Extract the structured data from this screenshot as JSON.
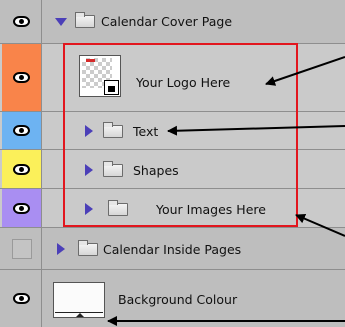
{
  "layers_panel": {
    "layers": [
      {
        "name": "Calendar Cover Page",
        "kind": "group",
        "expanded": true,
        "visible": true,
        "swatch": "#bebebe"
      },
      {
        "name": "Your Logo Here",
        "kind": "smart-object",
        "visible": true,
        "swatch": "#f9844a"
      },
      {
        "name": "Text",
        "kind": "group",
        "expanded": false,
        "visible": true,
        "swatch": "#6db3f2"
      },
      {
        "name": "Shapes",
        "kind": "group",
        "expanded": false,
        "visible": true,
        "swatch": "#fbf05a"
      },
      {
        "name": "Your Images Here",
        "kind": "group",
        "expanded": false,
        "visible": true,
        "swatch": "#a98ef2"
      },
      {
        "name": "Calendar Inside Pages",
        "kind": "group",
        "expanded": false,
        "visible": false,
        "swatch": "#bebebe"
      },
      {
        "name": "Background Colour",
        "kind": "layer",
        "visible": true,
        "swatch": "#bebebe"
      }
    ]
  },
  "annotations": {
    "highlight_color": "#e2161e",
    "arrow_color": "#000000"
  }
}
